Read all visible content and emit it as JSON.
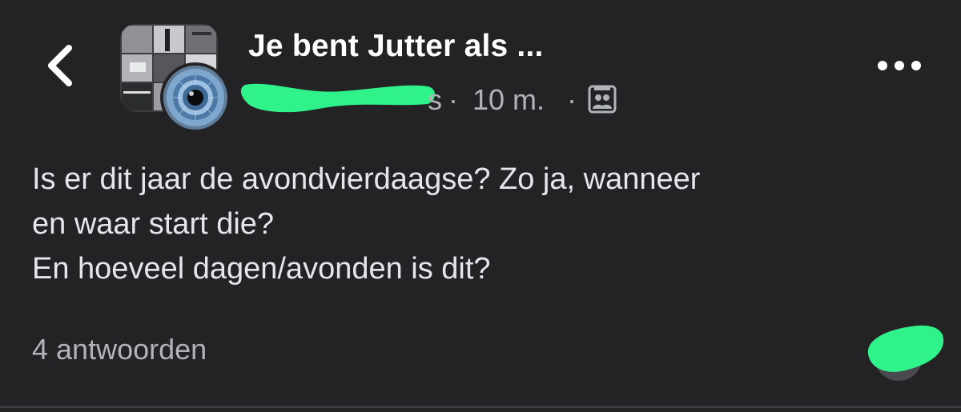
{
  "header": {
    "back_icon": "chevron-left-icon",
    "group_name": "Je bent Jutter als ...",
    "author_visible_tail": "s",
    "separator": "·",
    "time": "10 m.",
    "privacy_icon": "group-members-icon",
    "more_icon": "more-horizontal-icon"
  },
  "post": {
    "lines": [
      "Is er dit jaar de avondvierdaagse? Zo ja, wanneer",
      "en waar start die?",
      "En hoeveel dagen/avonden is dit?"
    ]
  },
  "footer": {
    "replies": "4 antwoorden"
  },
  "colors": {
    "background": "#232326",
    "primary_text": "#e4e6eb",
    "secondary_text": "#b0b3b8",
    "redaction": "#2ff28a"
  }
}
